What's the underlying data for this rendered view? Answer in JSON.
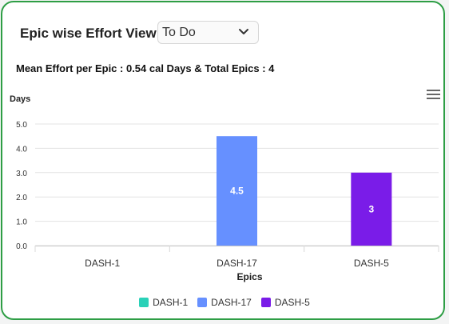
{
  "widget": {
    "title": "Epic wise Effort View",
    "status_select": {
      "value": "To Do"
    },
    "summary": "Mean Effort per Epic : 0.54 cal Days & Total Epics : 4"
  },
  "chart_data": {
    "type": "bar",
    "ylabel": "Days",
    "xlabel": "Epics",
    "ylim": [
      0,
      5
    ],
    "yticks": [
      "0.0",
      "1.0",
      "2.0",
      "3.0",
      "4.0",
      "5.0"
    ],
    "grid": true,
    "legend_position": "bottom",
    "categories": [
      "DASH-1",
      "DASH-17",
      "DASH-5"
    ],
    "values": [
      0,
      4.5,
      3
    ],
    "data_labels": [
      "",
      "4.5",
      "3"
    ],
    "colors": [
      "#2ad1b8",
      "#6690ff",
      "#7a1ce8"
    ]
  }
}
